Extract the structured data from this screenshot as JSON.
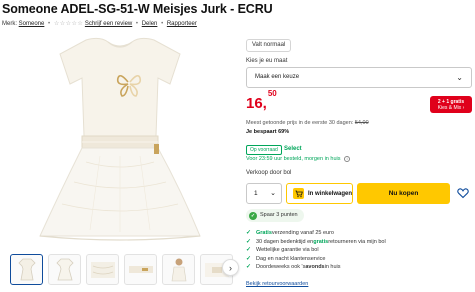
{
  "product": {
    "title": "Someone ADEL-SG-51-W Meisjes Jurk - ECRU",
    "brand_prefix": "Merk:",
    "brand": "Someone",
    "review_link": "Schrijf een review",
    "share_link": "Delen",
    "report_link": "Rapporteer"
  },
  "size": {
    "chip": "Valt normaal",
    "label": "Kies je eu maat",
    "placeholder": "Maak een keuze"
  },
  "price": {
    "whole": "16,",
    "cents": "50",
    "deal_line1": "2 + 1 gratis",
    "deal_line2": "Kies & Mix",
    "strike_prefix": "Meest getoonde prijs in de eerste 30 dagen:",
    "strike_value": "54,00",
    "saving": "Je bespaart 69%"
  },
  "delivery": {
    "badge": "Op voorraad",
    "select": "Select",
    "text": "Voor 23:59 uur besteld, morgen in huis",
    "seller": "Verkoop door bol"
  },
  "actions": {
    "quantity": "1",
    "cart_label": "In winkelwagen",
    "buy_label": "Nu kopen"
  },
  "points": {
    "text": "Spaar 3 punten"
  },
  "usps": [
    {
      "pre": "",
      "hl": "Gratis",
      "post": " verzending vanaf 25 euro"
    },
    {
      "pre": "30 dagen bedenktijd en ",
      "hl": "gratis",
      "post": " retourneren via mijn bol"
    },
    {
      "pre": "Wettelijke garantie via bol",
      "hl": "",
      "post": ""
    },
    {
      "pre": "Dag en nacht klantenservice",
      "hl": "",
      "post": ""
    },
    {
      "pre": "Doordeweeks ook 's ",
      "bold": "avonds",
      "post": " in huis"
    }
  ],
  "returns_link": "Bekijk retourvoorwaarden",
  "colors": {
    "price_red": "#e0001b",
    "stock_green": "#00a65a",
    "button_yellow": "#ffc800",
    "link_blue": "#0f4c9c"
  }
}
